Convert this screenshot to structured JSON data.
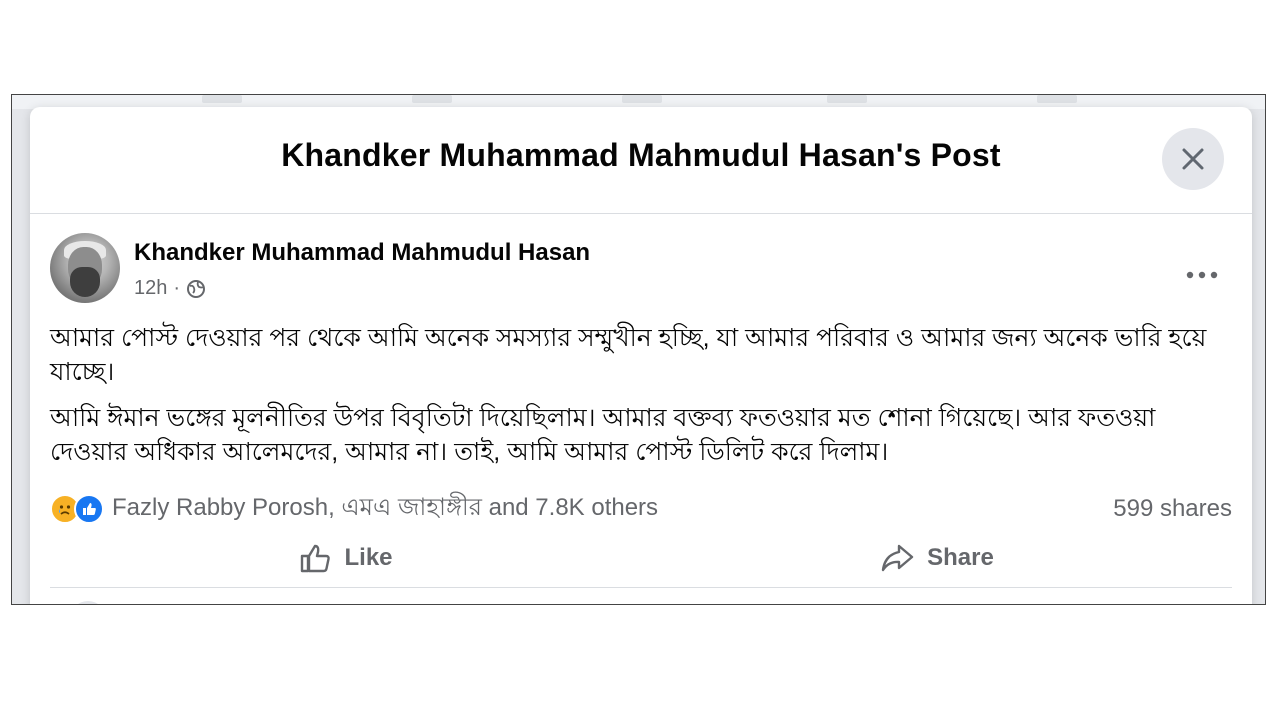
{
  "dialog": {
    "title": "Khandker Muhammad Mahmudul Hasan's Post",
    "close_icon": "close-icon"
  },
  "post": {
    "author": "Khandker Muhammad Mahmudul Hasan",
    "time": "12h",
    "separator": "·",
    "audience_icon": "globe-icon",
    "more_icon": "more-options-icon",
    "paragraphs": [
      "আমার পোস্ট দেওয়ার পর থেকে আমি অনেক সমস্যার সম্মুখীন হচ্ছি, যা আমার পরিবার ও আমার জন্য অনেক ভারি হয়ে যাচ্ছে।",
      "আমি ঈমান ভঙ্গের মূলনীতির উপর বিবৃতিটা দিয়েছিলাম। আমার বক্তব্য ফতওয়ার মত শোনা গিয়েছে। আর ফতওয়া দেওয়ার অধিকার আলেমদের, আমার না। তাই, আমি আমার পোস্ট ডিলিট করে দিলাম।"
    ]
  },
  "reactions": {
    "icons": [
      "sad-reaction-icon",
      "like-reaction-icon"
    ],
    "summary": "Fazly Rabby Porosh, এমএ জাহাঙ্গীর and 7.8K others",
    "shares": "599 shares"
  },
  "actions": {
    "like_label": "Like",
    "share_label": "Share"
  },
  "colors": {
    "primary_text": "#050505",
    "secondary_text": "#65676b",
    "like_blue": "#1877f2",
    "sad_yellow": "#f7b125",
    "close_bg": "#e4e6eb"
  }
}
